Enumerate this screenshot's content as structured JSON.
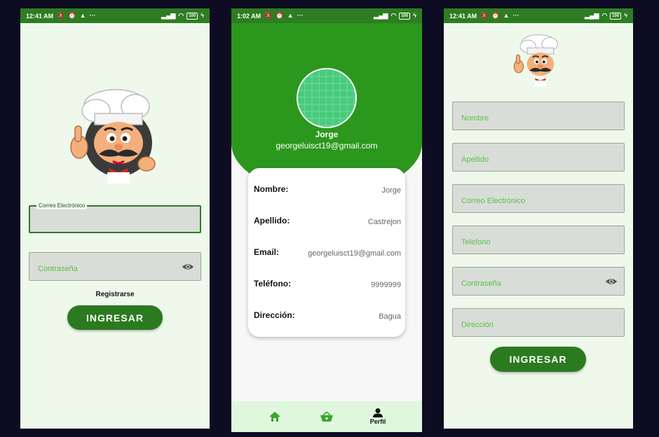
{
  "login": {
    "status_time": "12:41 AM",
    "battery": "100",
    "email_label": "Correo Electrónico",
    "password_placeholder": "Contraseña",
    "register_link": "Registrarse",
    "submit_label": "INGRESAR"
  },
  "profile": {
    "status_time": "1:02 AM",
    "battery": "100",
    "name": "Jorge",
    "email": "georgeluisct19@gmail.com",
    "rows": [
      {
        "label": "Nombre:",
        "value": "Jorge"
      },
      {
        "label": "Apellido:",
        "value": "Castrejon"
      },
      {
        "label": "Email:",
        "value": "georgeluisct19@gmail.com"
      },
      {
        "label": "Teléfono:",
        "value": "9999999"
      },
      {
        "label": "Dirección:",
        "value": "Bagua"
      }
    ],
    "nav": [
      {
        "icon": "home-icon",
        "label": ""
      },
      {
        "icon": "basket-icon",
        "label": ""
      },
      {
        "icon": "person-icon",
        "label": "Perfil"
      }
    ]
  },
  "register": {
    "status_time": "12:41 AM",
    "battery": "100",
    "fields": [
      "Nombre",
      "Apellido",
      "Correo Electrónico",
      "Telefono",
      "Contraseña",
      "Dirección"
    ],
    "submit_label": "INGRESAR"
  },
  "colors": {
    "primary": "#2e7d22",
    "header_green": "#2c971d",
    "hint_green": "#59c04a",
    "screen_bg": "#eef9ec"
  }
}
